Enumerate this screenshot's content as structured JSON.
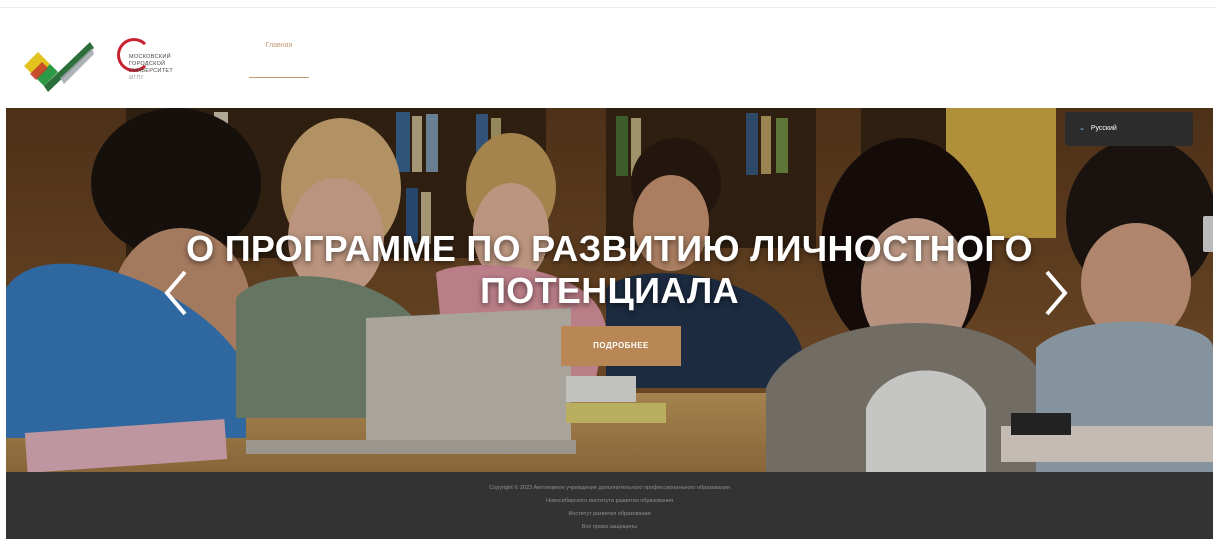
{
  "header": {
    "logo_left_icon": "checkmark-leaf-logo",
    "logo_right": {
      "lines": [
        "МОСКОВСКИЙ",
        "ГОРОДСКОЙ",
        "УНИВЕРСИТЕТ"
      ],
      "city": "МГПУ"
    },
    "nav": [
      {
        "label": "Главная"
      }
    ]
  },
  "hero": {
    "title_line1": "О ПРОГРАММЕ ПО РАЗВИТИЮ ЛИЧНОСТНОГО",
    "title_line2": "ПОТЕНЦИАЛА",
    "button_label": "ПОДРОБНЕЕ",
    "lang_label": "Русский",
    "prev_icon": "chevron-left-icon",
    "next_icon": "chevron-right-icon"
  },
  "footer": {
    "lines": [
      "Copyright © 2023 Автономное учреждение дополнительного профессионального образования",
      "Новосибирского института развития образования",
      "Институт развития образования",
      "Все права защищены"
    ]
  },
  "colors": {
    "accent": "#b88755",
    "nav_active": "#c39a72",
    "footer_bg": "#333333",
    "brand_red": "#c8212f"
  }
}
